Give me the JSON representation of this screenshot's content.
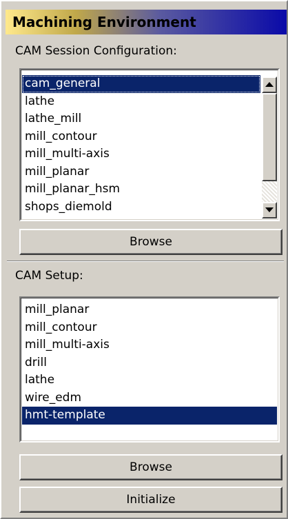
{
  "title": "Machining Environment",
  "session": {
    "label": "CAM Session Configuration:",
    "items": [
      "cam_general",
      "lathe",
      "lathe_mill",
      "mill_contour",
      "mill_multi-axis",
      "mill_planar",
      "mill_planar_hsm",
      "shops_diemold"
    ],
    "selected": "cam_general",
    "browse_label": "Browse"
  },
  "setup": {
    "label": "CAM Setup:",
    "items": [
      "mill_planar",
      "mill_contour",
      "mill_multi-axis",
      "drill",
      "lathe",
      "wire_edm",
      "hmt-template"
    ],
    "selected": "hmt-template",
    "browse_label": "Browse",
    "initialize_label": "Initialize"
  },
  "icons": {
    "scroll_up": "arrow-up-icon",
    "scroll_down": "arrow-down-icon"
  },
  "colors": {
    "selection": "#0a246a",
    "face": "#d4d0c8"
  }
}
